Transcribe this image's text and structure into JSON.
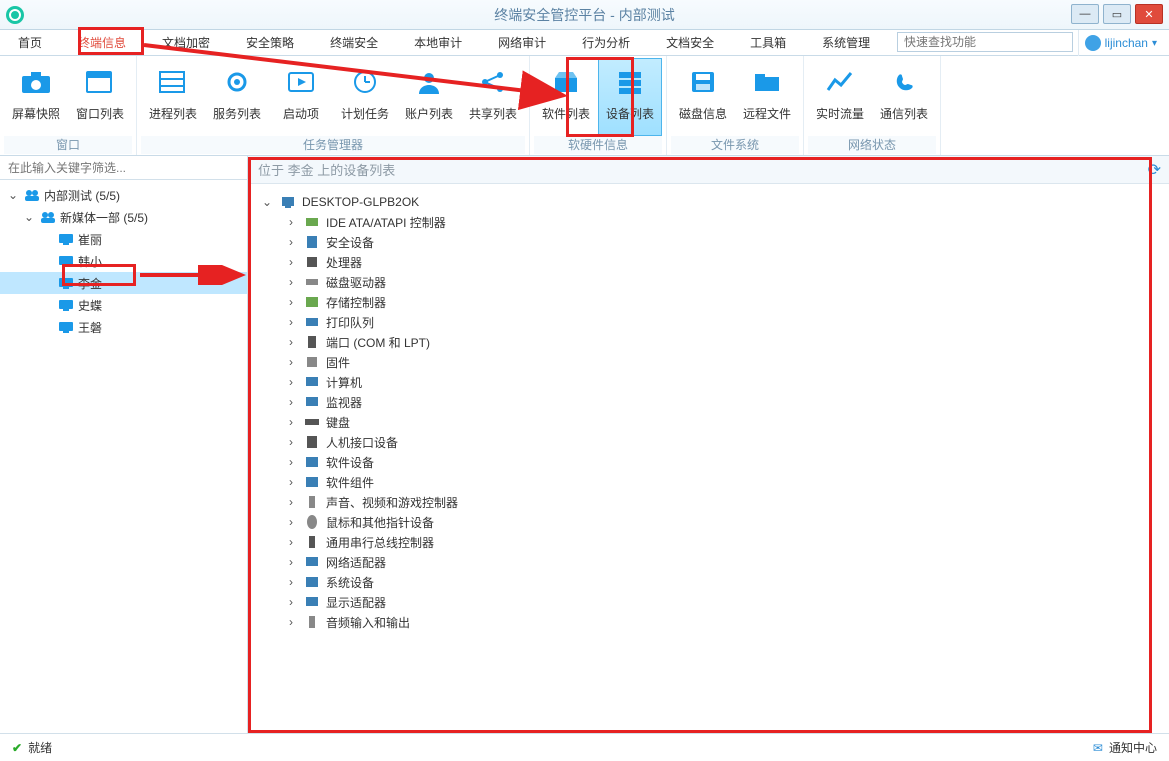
{
  "window": {
    "title": "终端安全管控平台 - 内部测试"
  },
  "menubar": {
    "items": [
      "首页",
      "终端信息",
      "文档加密",
      "安全策略",
      "终端安全",
      "本地审计",
      "网络审计",
      "行为分析",
      "文档安全",
      "工具箱",
      "系统管理"
    ],
    "active_index": 1,
    "search_placeholder": "快速查找功能",
    "user": "lijinchan"
  },
  "ribbon": {
    "groups": [
      {
        "name": "窗口",
        "buttons": [
          {
            "label": "屏幕快照",
            "icon": "camera"
          },
          {
            "label": "窗口列表",
            "icon": "windows"
          }
        ]
      },
      {
        "name": "任务管理器",
        "buttons": [
          {
            "label": "进程列表",
            "icon": "processes"
          },
          {
            "label": "服务列表",
            "icon": "gear"
          },
          {
            "label": "启动项",
            "icon": "play"
          },
          {
            "label": "计划任务",
            "icon": "schedule"
          },
          {
            "label": "账户列表",
            "icon": "user"
          },
          {
            "label": "共享列表",
            "icon": "share"
          }
        ]
      },
      {
        "name": "软硬件信息",
        "buttons": [
          {
            "label": "软件列表",
            "icon": "shop"
          },
          {
            "label": "设备列表",
            "icon": "device",
            "selected": true
          }
        ]
      },
      {
        "name": "文件系统",
        "buttons": [
          {
            "label": "磁盘信息",
            "icon": "save"
          },
          {
            "label": "远程文件",
            "icon": "folder"
          }
        ]
      },
      {
        "name": "网络状态",
        "buttons": [
          {
            "label": "实时流量",
            "icon": "chart"
          },
          {
            "label": "通信列表",
            "icon": "phone"
          }
        ]
      }
    ]
  },
  "side": {
    "filter_placeholder": "在此输入关键字筛选...",
    "tree": {
      "root": {
        "label": "内部测试 (5/5)"
      },
      "group": {
        "label": "新媒体一部 (5/5)"
      },
      "users": [
        "崔丽",
        "韩小",
        "李金",
        "史蝶",
        "王磐"
      ],
      "selected_index": 2
    }
  },
  "main": {
    "header": "位于 李金 上的设备列表",
    "root": "DESKTOP-GLPB2OK",
    "devices": [
      "IDE ATA/ATAPI 控制器",
      "安全设备",
      "处理器",
      "磁盘驱动器",
      "存储控制器",
      "打印队列",
      "端口 (COM 和 LPT)",
      "固件",
      "计算机",
      "监视器",
      "键盘",
      "人机接口设备",
      "软件设备",
      "软件组件",
      "声音、视频和游戏控制器",
      "鼠标和其他指针设备",
      "通用串行总线控制器",
      "网络适配器",
      "系统设备",
      "显示适配器",
      "音频输入和输出"
    ]
  },
  "status": {
    "text": "就绪",
    "notify": "通知中心"
  }
}
